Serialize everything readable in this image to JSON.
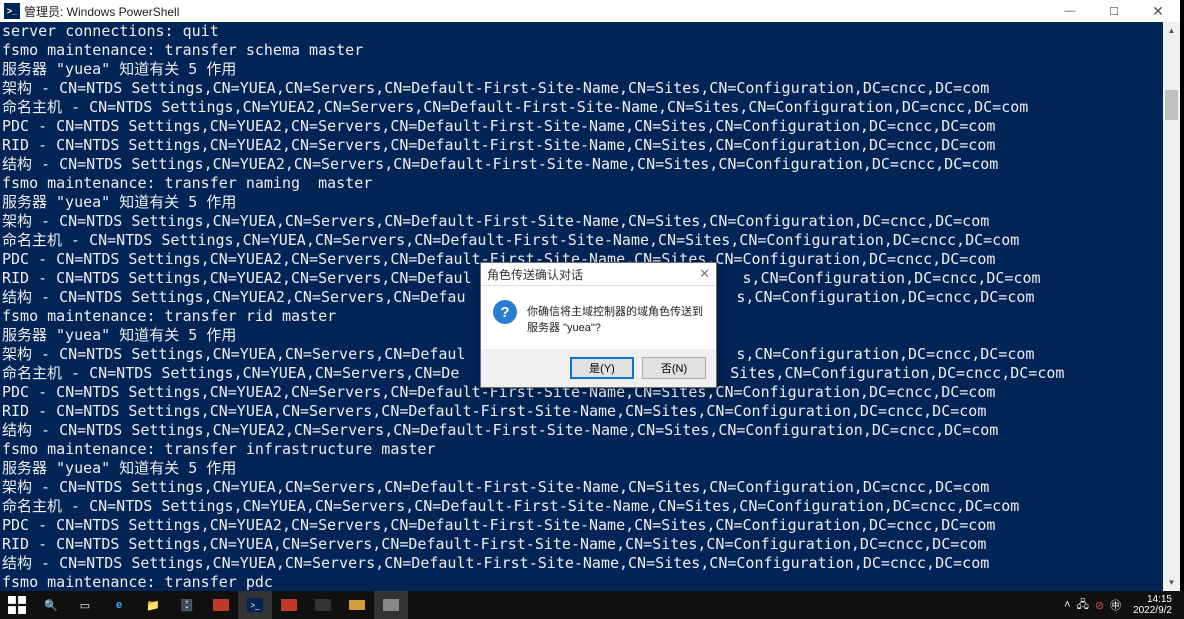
{
  "titlebar": {
    "icon_text": ">_",
    "title": "管理员: Windows PowerShell",
    "minimize": "—",
    "maximize": "☐",
    "close": "✕"
  },
  "console_lines": [
    "server connections: quit",
    "fsmo maintenance: transfer schema master",
    "服务器 \"yuea\" 知道有关 5 作用",
    "架构 - CN=NTDS Settings,CN=YUEA,CN=Servers,CN=Default-First-Site-Name,CN=Sites,CN=Configuration,DC=cncc,DC=com",
    "命名主机 - CN=NTDS Settings,CN=YUEA2,CN=Servers,CN=Default-First-Site-Name,CN=Sites,CN=Configuration,DC=cncc,DC=com",
    "PDC - CN=NTDS Settings,CN=YUEA2,CN=Servers,CN=Default-First-Site-Name,CN=Sites,CN=Configuration,DC=cncc,DC=com",
    "RID - CN=NTDS Settings,CN=YUEA2,CN=Servers,CN=Default-First-Site-Name,CN=Sites,CN=Configuration,DC=cncc,DC=com",
    "结构 - CN=NTDS Settings,CN=YUEA2,CN=Servers,CN=Default-First-Site-Name,CN=Sites,CN=Configuration,DC=cncc,DC=com",
    "fsmo maintenance: transfer naming  master",
    "服务器 \"yuea\" 知道有关 5 作用",
    "架构 - CN=NTDS Settings,CN=YUEA,CN=Servers,CN=Default-First-Site-Name,CN=Sites,CN=Configuration,DC=cncc,DC=com",
    "命名主机 - CN=NTDS Settings,CN=YUEA,CN=Servers,CN=Default-First-Site-Name,CN=Sites,CN=Configuration,DC=cncc,DC=com",
    "PDC - CN=NTDS Settings,CN=YUEA2,CN=Servers,CN=Default-First-Site-Name,CN=Sites,CN=Configuration,DC=cncc,DC=com",
    "RID - CN=NTDS Settings,CN=YUEA2,CN=Servers,CN=Defaul                              s,CN=Configuration,DC=cncc,DC=com",
    "结构 - CN=NTDS Settings,CN=YUEA2,CN=Servers,CN=Defau                              s,CN=Configuration,DC=cncc,DC=com",
    "fsmo maintenance: transfer rid master",
    "服务器 \"yuea\" 知道有关 5 作用",
    "架构 - CN=NTDS Settings,CN=YUEA,CN=Servers,CN=Defaul                              s,CN=Configuration,DC=cncc,DC=com",
    "命名主机 - CN=NTDS Settings,CN=YUEA,CN=Servers,CN=De                              Sites,CN=Configuration,DC=cncc,DC=com",
    "PDC - CN=NTDS Settings,CN=YUEA2,CN=Servers,CN=Default-First-Site-Name,CN=Sites,CN=Configuration,DC=cncc,DC=com",
    "RID - CN=NTDS Settings,CN=YUEA,CN=Servers,CN=Default-First-Site-Name,CN=Sites,CN=Configuration,DC=cncc,DC=com",
    "结构 - CN=NTDS Settings,CN=YUEA2,CN=Servers,CN=Default-First-Site-Name,CN=Sites,CN=Configuration,DC=cncc,DC=com",
    "fsmo maintenance: transfer infrastructure master",
    "服务器 \"yuea\" 知道有关 5 作用",
    "架构 - CN=NTDS Settings,CN=YUEA,CN=Servers,CN=Default-First-Site-Name,CN=Sites,CN=Configuration,DC=cncc,DC=com",
    "命名主机 - CN=NTDS Settings,CN=YUEA,CN=Servers,CN=Default-First-Site-Name,CN=Sites,CN=Configuration,DC=cncc,DC=com",
    "PDC - CN=NTDS Settings,CN=YUEA2,CN=Servers,CN=Default-First-Site-Name,CN=Sites,CN=Configuration,DC=cncc,DC=com",
    "RID - CN=NTDS Settings,CN=YUEA,CN=Servers,CN=Default-First-Site-Name,CN=Sites,CN=Configuration,DC=cncc,DC=com",
    "结构 - CN=NTDS Settings,CN=YUEA,CN=Servers,CN=Default-First-Site-Name,CN=Sites,CN=Configuration,DC=cncc,DC=com",
    "fsmo maintenance: transfer pdc"
  ],
  "dialog": {
    "title": "角色传送确认对话",
    "close": "✕",
    "icon": "?",
    "message": "你确信将主域控制器的域角色传送到服务器 \"yuea\"?",
    "yes": "是(Y)",
    "no": "否(N)"
  },
  "scrollbar": {
    "up": "▲",
    "down": "▼"
  },
  "taskbar": {
    "tray_chevron": "˄",
    "time": "14:15",
    "date": "2022/9/2"
  }
}
